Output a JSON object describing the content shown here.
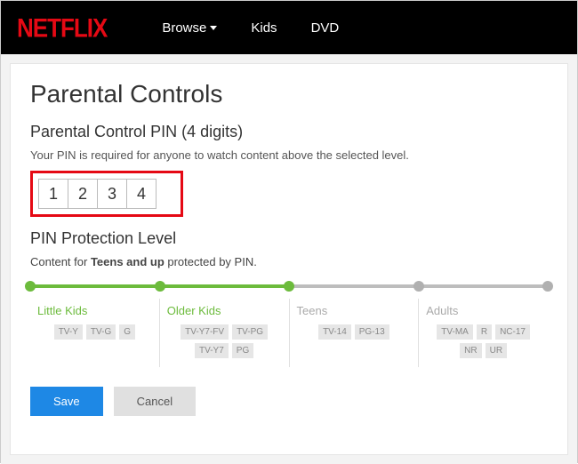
{
  "header": {
    "logo": "NETFLIX",
    "nav": {
      "browse": "Browse",
      "kids": "Kids",
      "dvd": "DVD"
    }
  },
  "page": {
    "title": "Parental Controls",
    "pinSection": {
      "heading": "Parental Control PIN (4 digits)",
      "description": "Your PIN is required for anyone to watch content above the selected level.",
      "digits": [
        "1",
        "2",
        "3",
        "4"
      ]
    },
    "levelSection": {
      "heading": "PIN Protection Level",
      "protectPrefix": "Content for ",
      "protectBold": "Teens and up",
      "protectSuffix": " protected by PIN.",
      "fillPercent": "50%",
      "dots": [
        {
          "pos": "0%",
          "class": "green"
        },
        {
          "pos": "25%",
          "class": "green"
        },
        {
          "pos": "50%",
          "class": "green"
        },
        {
          "pos": "75%",
          "class": "gray"
        },
        {
          "pos": "100%",
          "class": "gray"
        }
      ],
      "levels": [
        {
          "title": "Little Kids",
          "active": true,
          "ratings": [
            "TV-Y",
            "TV-G",
            "G"
          ]
        },
        {
          "title": "Older Kids",
          "active": true,
          "ratings": [
            "TV-Y7-FV",
            "TV-PG",
            "TV-Y7",
            "PG"
          ]
        },
        {
          "title": "Teens",
          "active": false,
          "ratings": [
            "TV-14",
            "PG-13"
          ]
        },
        {
          "title": "Adults",
          "active": false,
          "ratings": [
            "TV-MA",
            "R",
            "NC-17",
            "NR",
            "UR"
          ]
        }
      ]
    },
    "actions": {
      "save": "Save",
      "cancel": "Cancel"
    }
  }
}
